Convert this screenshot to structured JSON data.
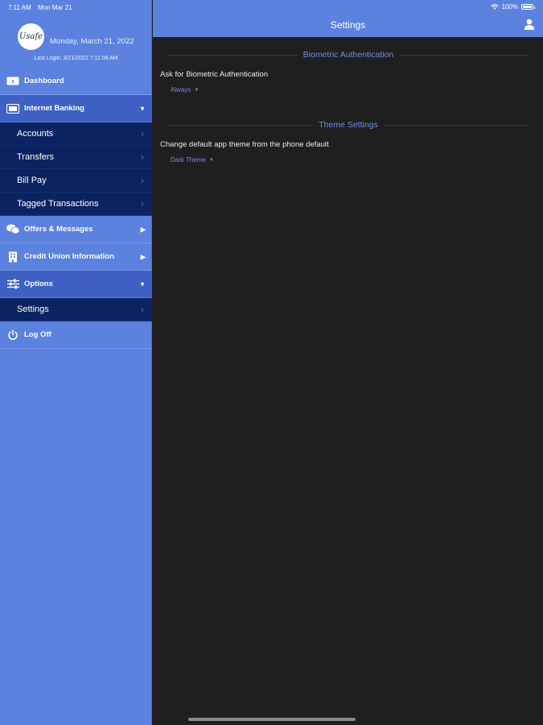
{
  "status_bar": {
    "time": "7:11 AM",
    "date": "Mon Mar 21",
    "battery": "100%"
  },
  "sidebar": {
    "logo_text": "Usafe",
    "profile_date": "Monday, March 21, 2022",
    "last_login": "Last Login: 3/21/2022 7:11:08 AM",
    "items": [
      {
        "label": "Dashboard"
      },
      {
        "label": "Internet Banking"
      },
      {
        "label": "Accounts"
      },
      {
        "label": "Transfers"
      },
      {
        "label": "Bill Pay"
      },
      {
        "label": "Tagged Transactions"
      },
      {
        "label": "Offers & Messages"
      },
      {
        "label": "Credit Union Information"
      },
      {
        "label": "Options"
      },
      {
        "label": "Settings"
      },
      {
        "label": "Log Off"
      }
    ],
    "icons": [
      "dashboard-icon",
      "internet-banking-icon",
      "offers-icon",
      "building-icon",
      "sliders-icon",
      "power-icon"
    ]
  },
  "header": {
    "title": "Settings"
  },
  "sections": [
    {
      "title": "Biometric Authentication",
      "label": "Ask for Biometric Authentication",
      "value": "Always"
    },
    {
      "title": "Theme Settings",
      "label": "Change default app theme from the phone default",
      "value": "Dark Theme"
    }
  ],
  "colors": {
    "sidebar": "#5b82df",
    "sidebar_active": "#3f60c4",
    "submenu": "#0b2361",
    "background": "#1f1f1f",
    "accent": "#6c8fe6"
  }
}
